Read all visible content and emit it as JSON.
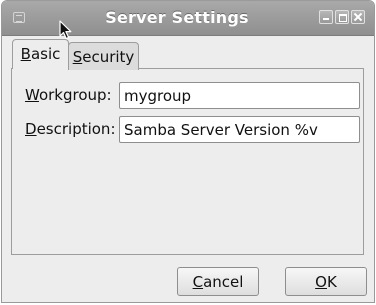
{
  "window": {
    "title": "Server Settings"
  },
  "tabs": [
    {
      "accel": "B",
      "rest": "asic",
      "selected": true
    },
    {
      "accel": "S",
      "rest": "ecurity",
      "selected": false
    }
  ],
  "form": {
    "workgroup": {
      "accel": "W",
      "rest": "orkgroup:",
      "value": "mygroup"
    },
    "description": {
      "accel": "D",
      "rest": "escription:",
      "value": "Samba Server Version %v"
    }
  },
  "buttons": {
    "cancel": {
      "accel": "C",
      "rest": "ancel"
    },
    "ok": {
      "accel": "O",
      "rest": "K"
    }
  },
  "icons": {
    "app": "app-icon",
    "minimize": "minimize-icon",
    "maximize": "maximize-icon",
    "close": "close-icon",
    "cursor": "mouse-pointer-icon"
  }
}
